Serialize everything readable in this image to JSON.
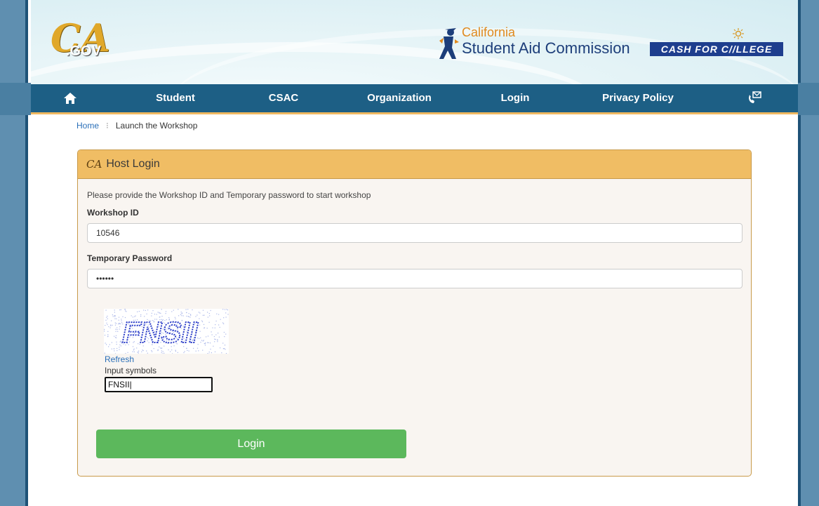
{
  "header": {
    "ca_logo": {
      "mark": "CA",
      "suffix": ".GOV"
    },
    "csac_logo": {
      "line1": "California",
      "line2": "Student Aid Commission"
    },
    "cfc_logo": "CASH FOR C//LLEGE"
  },
  "nav": {
    "home_icon": "home-icon",
    "items": [
      "Student",
      "CSAC",
      "Organization",
      "Login",
      "Privacy Policy"
    ],
    "contact_icon": "phone-mail-icon"
  },
  "breadcrumb": {
    "home": "Home",
    "separator": "⁝",
    "current": "Launch the Workshop"
  },
  "panel": {
    "logo_text": "CA",
    "title": "Host Login",
    "intro": "Please provide the Workshop ID and Temporary password to start workshop",
    "workshop_id_label": "Workshop ID",
    "workshop_id_value": "10546",
    "password_label": "Temporary Password",
    "password_value": "••••••",
    "captcha_text": "FNSII",
    "refresh_label": "Refresh",
    "input_symbols_label": "Input symbols",
    "captcha_input_value": "FNSII|",
    "login_label": "Login"
  },
  "colors": {
    "nav_bg": "#1d5f85",
    "nav_underline": "#f0b860",
    "panel_head": "#f0bd64",
    "panel_bg": "#f9f5f1",
    "login_button": "#5cb85c",
    "link": "#2a6fb8"
  }
}
